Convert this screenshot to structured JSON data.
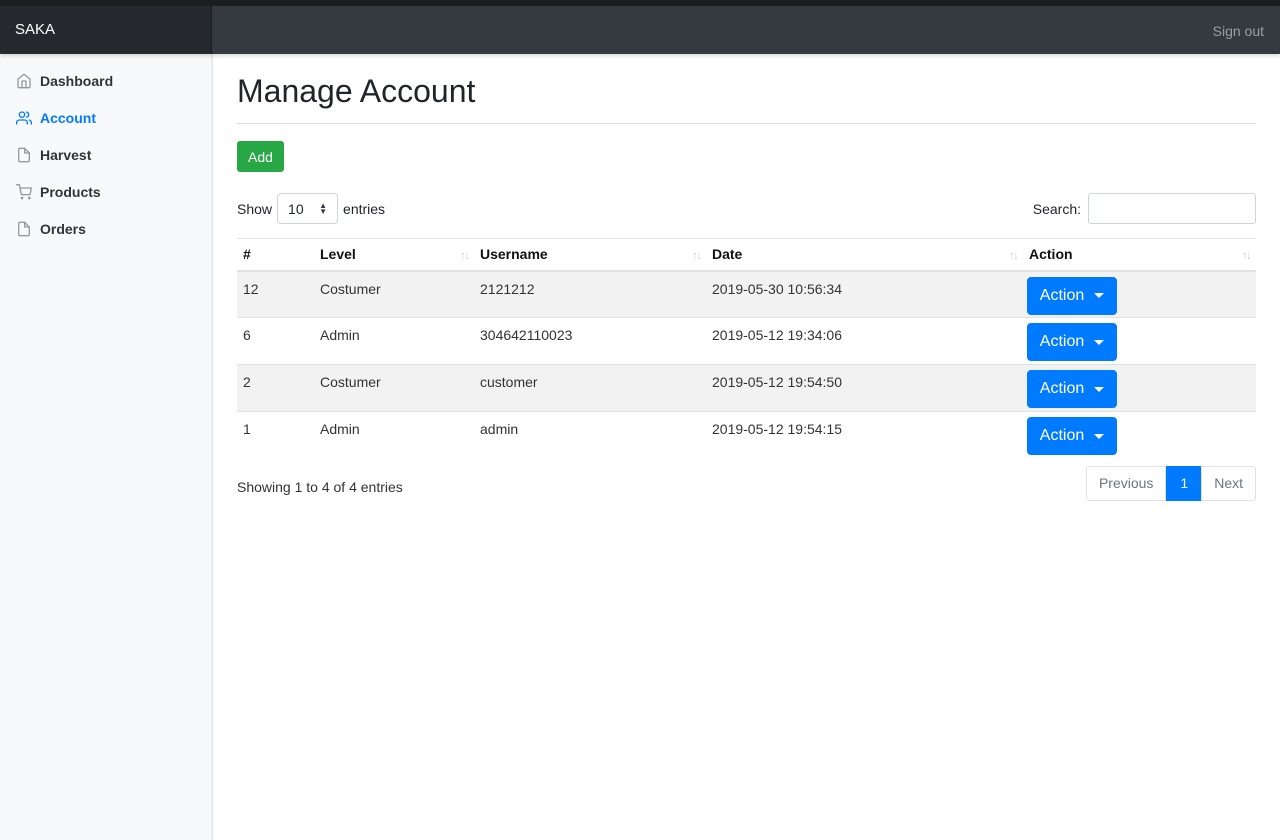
{
  "app": {
    "brand": "SAKA",
    "signout_label": "Sign out"
  },
  "sidebar": {
    "items": [
      {
        "label": "Dashboard",
        "icon": "home-icon",
        "active": false
      },
      {
        "label": "Account",
        "icon": "users-icon",
        "active": true
      },
      {
        "label": "Harvest",
        "icon": "file-icon",
        "active": false
      },
      {
        "label": "Products",
        "icon": "cart-icon",
        "active": false
      },
      {
        "label": "Orders",
        "icon": "file-icon",
        "active": false
      }
    ]
  },
  "main": {
    "title": "Manage Account",
    "add_label": "Add",
    "length": {
      "show_label": "Show",
      "value": "10",
      "entries_label": "entries"
    },
    "search": {
      "label": "Search:",
      "value": ""
    },
    "table": {
      "columns": [
        "#",
        "Level",
        "Username",
        "Date",
        "Action"
      ],
      "rows": [
        {
          "id": "12",
          "level": "Costumer",
          "username": "2121212",
          "date": "2019-05-30 10:56:34",
          "action": "Action"
        },
        {
          "id": "6",
          "level": "Admin",
          "username": "304642110023",
          "date": "2019-05-12 19:34:06",
          "action": "Action"
        },
        {
          "id": "2",
          "level": "Costumer",
          "username": "customer",
          "date": "2019-05-12 19:54:50",
          "action": "Action"
        },
        {
          "id": "1",
          "level": "Admin",
          "username": "admin",
          "date": "2019-05-12 19:54:15",
          "action": "Action"
        }
      ]
    },
    "info": "Showing 1 to 4 of 4 entries",
    "pagination": {
      "previous": "Previous",
      "current": "1",
      "next": "Next"
    }
  },
  "colors": {
    "primary": "#007bff",
    "success": "#28a745",
    "navbar": "#343a40"
  }
}
